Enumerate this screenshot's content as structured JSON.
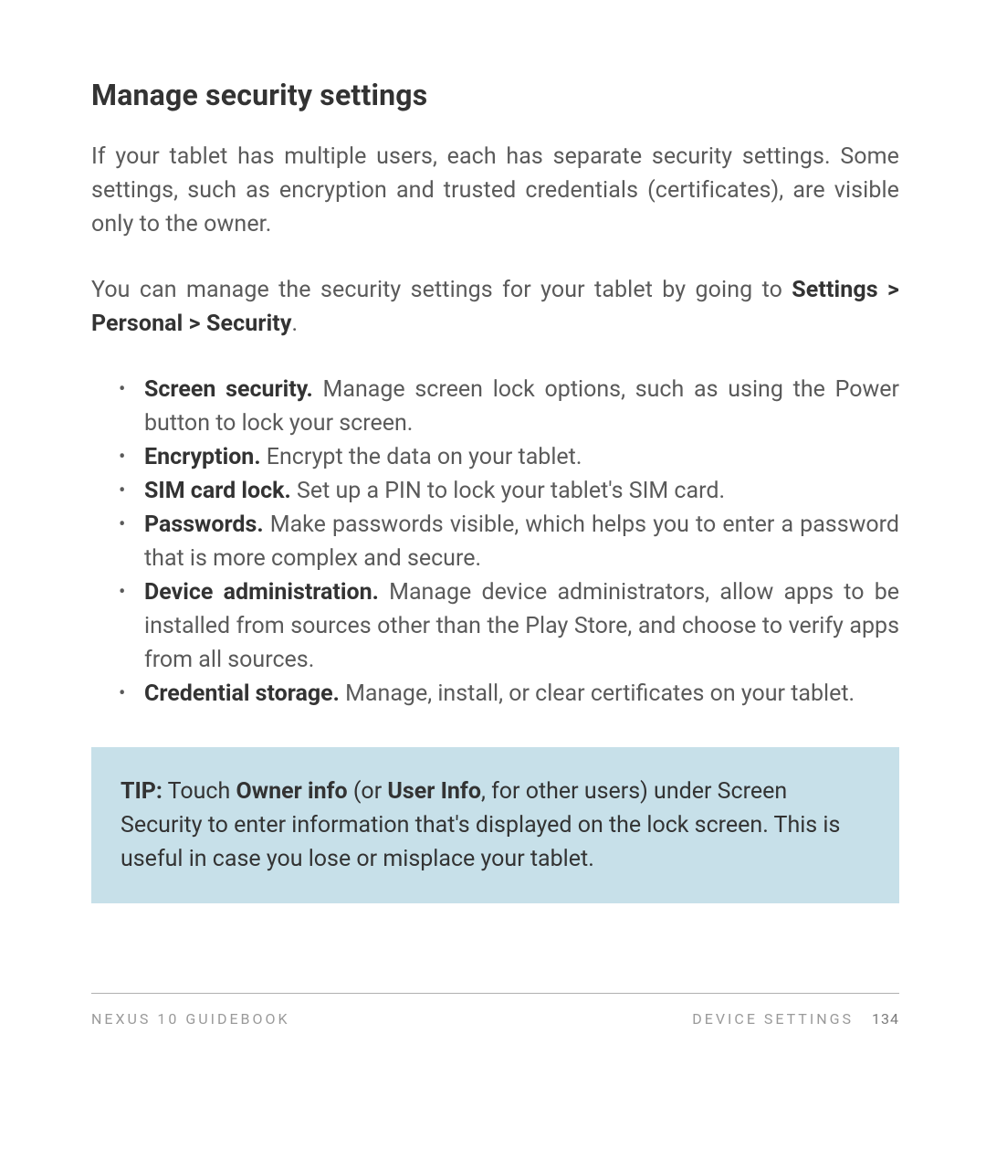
{
  "heading": "Manage security settings",
  "para1": "If your tablet has multiple users, each has separate security settings. Some settings, such as encryption and trusted credentials (certificates), are visible only to the owner.",
  "para2_pre": "You can manage the security settings for your tablet by going to ",
  "para2_bold": "Settings > Personal > Security",
  "para2_post": ".",
  "bullets": [
    {
      "bold": "Screen security.",
      "rest": " Manage screen lock options, such as using the Power button to lock your screen."
    },
    {
      "bold": "Encryption.",
      "rest": " Encrypt the data on your tablet."
    },
    {
      "bold": "SIM card lock.",
      "rest": " Set up a PIN to lock your tablet's SIM card."
    },
    {
      "bold": "Passwords.",
      "rest": " Make passwords visible, which helps you to enter a password that is more complex and secure."
    },
    {
      "bold": "Device administration.",
      "rest": " Manage device administrators, allow apps to be installed from sources other than the Play Store, and choose to verify apps from all sources."
    },
    {
      "bold": "Credential storage.",
      "rest": " Manage, install, or clear certificates on your tablet."
    }
  ],
  "tip": {
    "label": "TIP:",
    "t1": " Touch ",
    "b1": "Owner info",
    "t2": " (or ",
    "b2": "User Info",
    "t3": ", for other users) under Screen Security to enter information that's displayed on the lock screen. This is useful in case you lose or misplace your tablet."
  },
  "footer": {
    "left": "NEXUS 10 GUIDEBOOK",
    "section": "DEVICE SETTINGS",
    "page": "134"
  }
}
